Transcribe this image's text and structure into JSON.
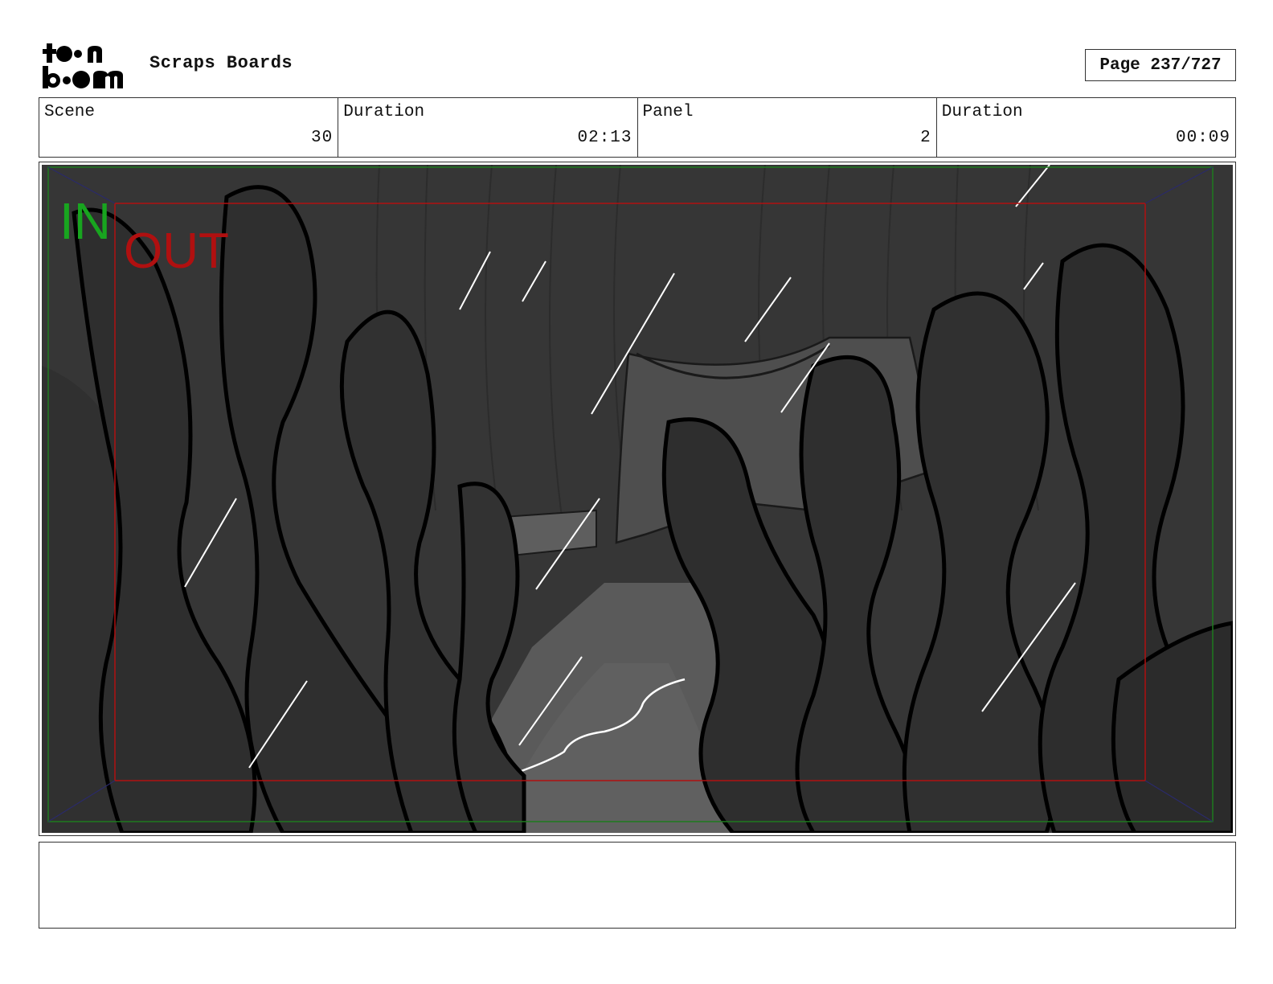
{
  "header": {
    "logo_alt": "toon boom",
    "board_title": "Scraps Boards",
    "page_label": "Page 237/727"
  },
  "info": {
    "scene_label": "Scene",
    "scene_value": "30",
    "scene_duration_label": "Duration",
    "scene_duration_value": "02:13",
    "panel_label": "Panel",
    "panel_value": "2",
    "panel_duration_label": "Duration",
    "panel_duration_value": "00:09"
  },
  "frame": {
    "in_label": "IN",
    "out_label": "OUT",
    "in_color": "#18a51f",
    "out_color": "#b01010"
  },
  "notes": {
    "text": ""
  }
}
